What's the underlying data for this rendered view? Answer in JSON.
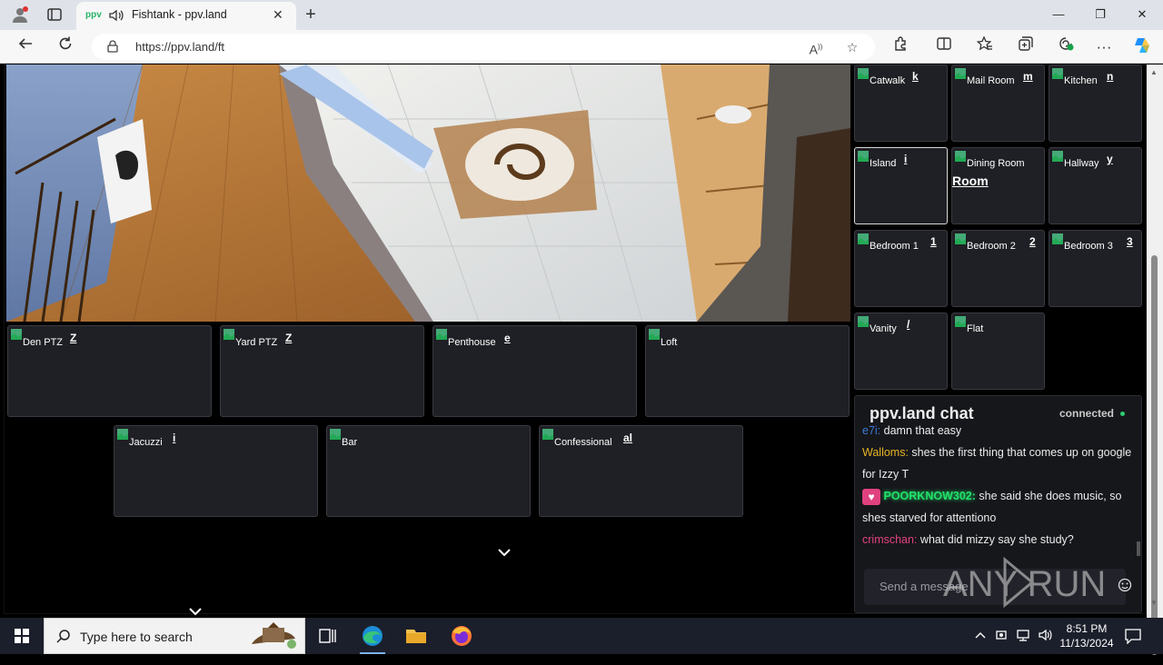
{
  "browser": {
    "tab_title": "Fishtank - ppv.land",
    "url": "https://ppv.land/ft",
    "new_tab_symbol": "+",
    "close_tab_symbol": "✕",
    "window_controls": [
      "—",
      "❐",
      "✕"
    ]
  },
  "cameras_bottom_row1": [
    {
      "label": "Den PTZ",
      "key": "Z"
    },
    {
      "label": "Yard PTZ",
      "key": "Z"
    },
    {
      "label": "Penthouse",
      "key": "e"
    },
    {
      "label": "Loft",
      "key": ""
    }
  ],
  "cameras_bottom_row2": [
    {
      "label": "Jacuzzi",
      "key": "i"
    },
    {
      "label": "Bar",
      "key": ""
    },
    {
      "label": "Confessional",
      "key": "al"
    }
  ],
  "cameras_side": [
    {
      "label": "Catwalk",
      "key": "k"
    },
    {
      "label": "Mail Room",
      "key": "m"
    },
    {
      "label": "Kitchen",
      "key": "n"
    },
    {
      "label": "Island",
      "key": "i"
    },
    {
      "label": "Dining Room",
      "key": "Room"
    },
    {
      "label": "Hallway",
      "key": "y"
    },
    {
      "label": "Bedroom 1",
      "key": "1"
    },
    {
      "label": "Bedroom 2",
      "key": "2"
    },
    {
      "label": "Bedroom 3",
      "key": "3"
    },
    {
      "label": "Vanity",
      "key": "/"
    },
    {
      "label": "Flat",
      "key": ""
    }
  ],
  "chat": {
    "title": "ppv.land chat",
    "status": "connected",
    "messages": [
      {
        "user": "e7i:",
        "text": "damn that easy",
        "color": "#3b7bd9"
      },
      {
        "user": "Walloms:",
        "text": "shes the first thing that comes up on google for Izzy T",
        "color": "#e6b422"
      },
      {
        "user": "POORKNOW302:",
        "text": "she said she does music, so shes starved for attentiono",
        "color": "#22e06a"
      },
      {
        "user": "crimschan:",
        "text": "what did mizzy say she study?",
        "color": "#e0417f"
      }
    ],
    "input_placeholder": "Send a message"
  },
  "taskbar": {
    "search_placeholder": "Type here to search",
    "time": "8:51 PM",
    "date": "11/13/2024"
  },
  "watermark": "ANY RUN"
}
